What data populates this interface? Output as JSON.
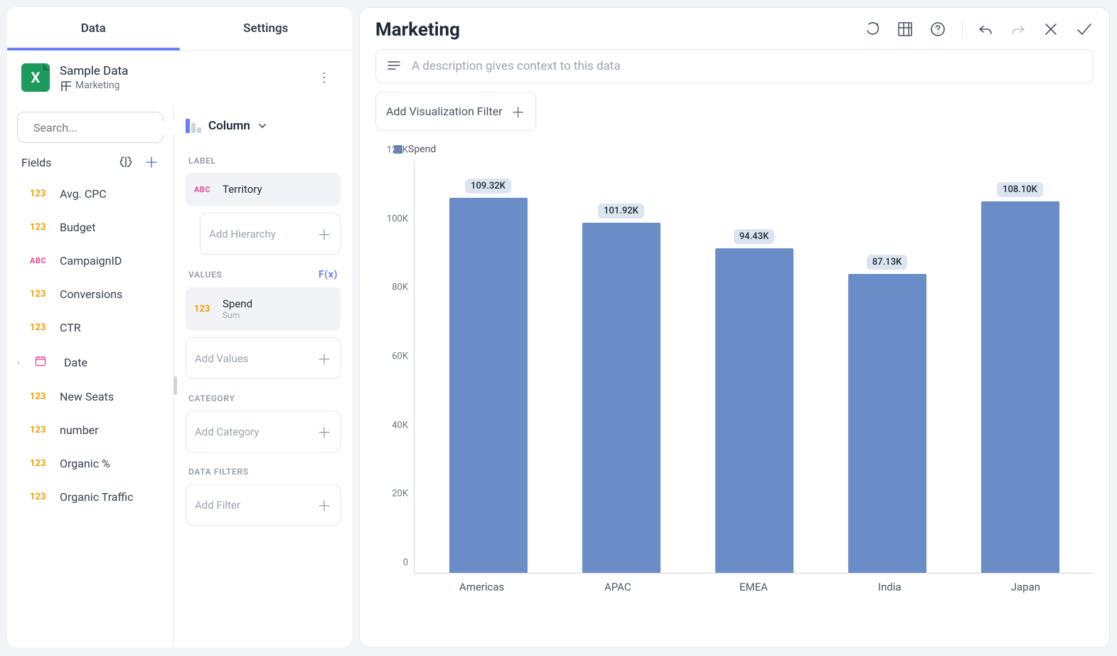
{
  "tabs": {
    "data": "Data",
    "settings": "Settings"
  },
  "datasource": {
    "title": "Sample Data",
    "subtitle": "Marketing"
  },
  "search": {
    "placeholder": "Search..."
  },
  "fields_header": "Fields",
  "fields": [
    {
      "type": "123",
      "type_class": "type-num",
      "name": "Avg. CPC"
    },
    {
      "type": "123",
      "type_class": "type-num",
      "name": "Budget"
    },
    {
      "type": "ABC",
      "type_class": "type-abc",
      "name": "CampaignID"
    },
    {
      "type": "123",
      "type_class": "type-num",
      "name": "Conversions"
    },
    {
      "type": "123",
      "type_class": "type-num",
      "name": "CTR"
    },
    {
      "type": "date",
      "type_class": "type-date",
      "name": "Date",
      "expandable": true
    },
    {
      "type": "123",
      "type_class": "type-num",
      "name": "New Seats"
    },
    {
      "type": "123",
      "type_class": "type-num",
      "name": "number"
    },
    {
      "type": "123",
      "type_class": "type-num",
      "name": "Organic %"
    },
    {
      "type": "123",
      "type_class": "type-num",
      "name": "Organic Traffic"
    }
  ],
  "viz_type": "Column",
  "config": {
    "label_section": "LABEL",
    "label_chip": {
      "type": "ABC",
      "name": "Territory"
    },
    "add_hierarchy": "Add Hierarchy",
    "values_section": "VALUES",
    "fx": "F(x)",
    "value_chip": {
      "type": "123",
      "name": "Spend",
      "agg": "Sum"
    },
    "add_values": "Add Values",
    "category_section": "CATEGORY",
    "add_category": "Add Category",
    "filters_section": "DATA FILTERS",
    "add_filter": "Add Filter"
  },
  "main": {
    "title": "Marketing",
    "description_placeholder": "A description gives context to this data",
    "add_filter": "Add Visualization Filter",
    "legend": "Spend"
  },
  "chart_data": {
    "type": "bar",
    "title": "Marketing",
    "ylabel": "",
    "xlabel": "",
    "ylim": [
      0,
      120000
    ],
    "yticks": [
      "0",
      "20K",
      "40K",
      "60K",
      "80K",
      "100K",
      "120K"
    ],
    "categories": [
      "Americas",
      "APAC",
      "EMEA",
      "India",
      "Japan"
    ],
    "series": [
      {
        "name": "Spend",
        "values": [
          109320,
          101920,
          94430,
          87130,
          108100
        ],
        "labels": [
          "109.32K",
          "101.92K",
          "94.43K",
          "87.13K",
          "108.10K"
        ]
      }
    ]
  }
}
